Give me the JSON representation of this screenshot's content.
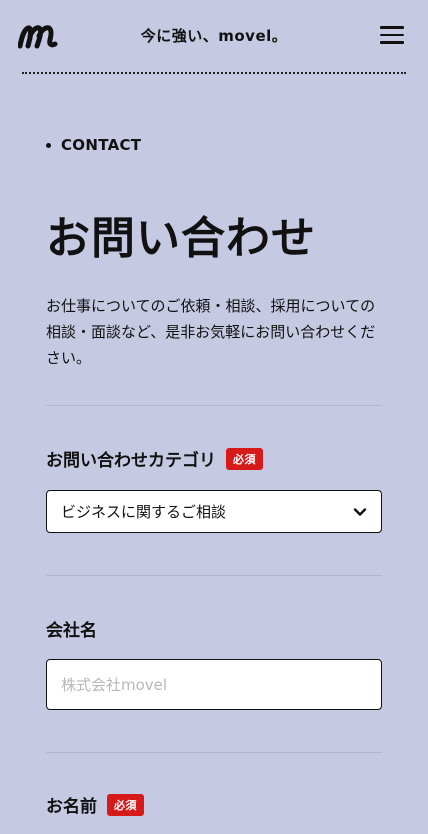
{
  "header": {
    "tagline": "今に強い、movel。",
    "menu_icon": "hamburger-menu-icon",
    "logo_icon": "movel-logo-icon"
  },
  "hero": {
    "eyebrow": "CONTACT",
    "title": "お問い合わせ",
    "lead": "お仕事についてのご依頼・相談、採用についての相談・面談など、是非お気軽にお問い合わせください。"
  },
  "form": {
    "category": {
      "label": "お問い合わせカテゴリ",
      "required": "必須",
      "selected": "ビジネスに関するご相談"
    },
    "company": {
      "label": "会社名",
      "placeholder": "株式会社movel",
      "value": ""
    },
    "name": {
      "label": "お名前",
      "required": "必須"
    }
  },
  "colors": {
    "background": "#c6c9e2",
    "required_badge": "#d61a1a",
    "text": "#111111"
  }
}
